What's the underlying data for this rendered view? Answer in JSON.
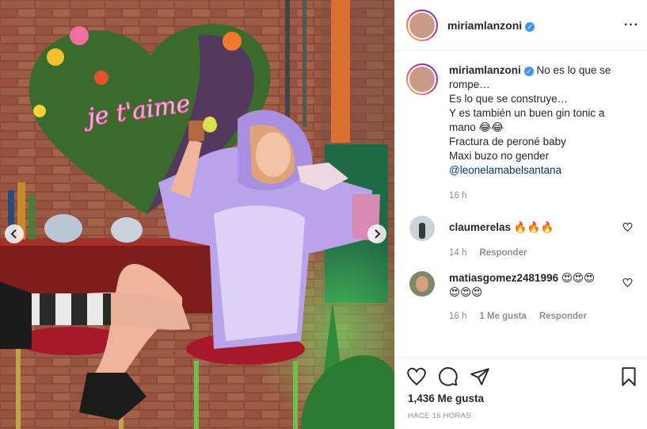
{
  "post": {
    "username": "miriamlanzoni",
    "neon_sign": "je t'aime",
    "caption_lines": [
      "No es lo que se",
      "rompe…",
      "Es lo que se construye…",
      "Y es también un buen gin tonic a",
      "mano 😂😂",
      "Fractura de peroné baby",
      "Maxi buzo no gender"
    ],
    "mention": "@leonelamabelsantana",
    "caption_time": "16 h",
    "likes": "1,436 Me gusta",
    "time_ago": "HACE 16 HORAS"
  },
  "comments": [
    {
      "username": "claumerelas",
      "text": "🔥🔥🔥",
      "time": "14 h",
      "likes": "",
      "reply": "Responder"
    },
    {
      "username": "matiasgomez2481996",
      "text": "😍😍😍",
      "text2": "😍😍😍",
      "time": "16 h",
      "likes": "1 Me gusta",
      "reply": "Responder"
    }
  ],
  "icons": {
    "more": "more-options-icon",
    "like": "heart-icon",
    "comment": "comment-icon",
    "share": "share-icon",
    "save": "bookmark-icon",
    "prev": "chevron-left-icon",
    "next": "chevron-right-icon"
  },
  "colors": {
    "link": "#00376b",
    "verified": "#3897f0",
    "muted": "#8e8e8e",
    "neon": "#ff5fb8",
    "hoodie": "#b9a3ea"
  }
}
